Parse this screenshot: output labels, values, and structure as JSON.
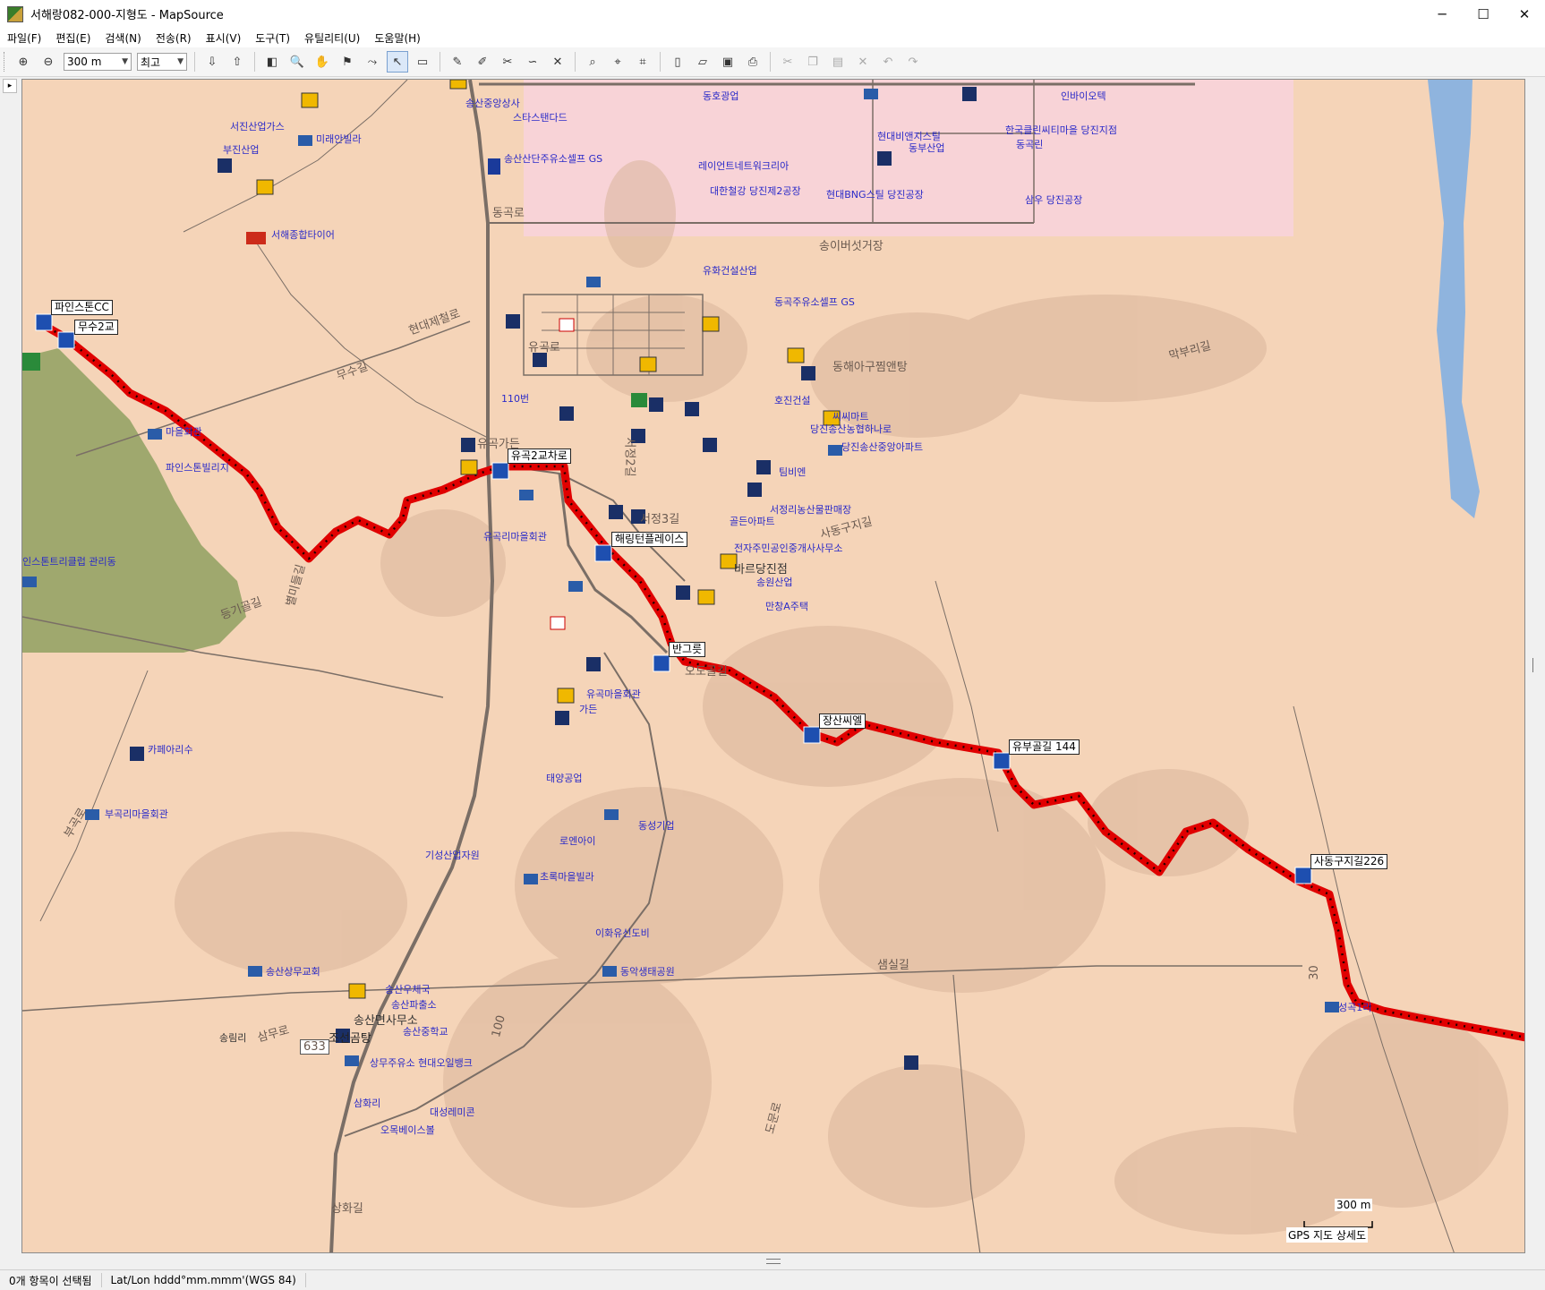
{
  "window": {
    "title": "서해랑082-000-지형도 - MapSource",
    "controls": {
      "minimize": "─",
      "maximize": "☐",
      "close": "✕"
    }
  },
  "menu": [
    "파일(F)",
    "편집(E)",
    "검색(N)",
    "전송(R)",
    "표시(V)",
    "도구(T)",
    "유틸리티(U)",
    "도움말(H)"
  ],
  "toolbar": {
    "zoom_value": "300 m",
    "detail_value": "최고"
  },
  "map": {
    "colors": {
      "land": "#f5d4b8",
      "urban": "#f8d3d7",
      "water": "#8fb4de",
      "golf": "#9fa86e",
      "route": "#e00000",
      "road": "#7a6e66"
    },
    "road_labels": [
      {
        "text": "동곡로"
      },
      {
        "text": "현대제철로"
      },
      {
        "text": "무수길"
      },
      {
        "text": "유곡로"
      },
      {
        "text": "서정2길"
      },
      {
        "text": "서정3길"
      },
      {
        "text": "등기골길"
      },
      {
        "text": "별미들길"
      },
      {
        "text": "사동구지길"
      },
      {
        "text": "오도골길"
      },
      {
        "text": "샘실길"
      },
      {
        "text": "삼무로"
      },
      {
        "text": "도문로"
      },
      {
        "text": "상화길"
      },
      {
        "text": "유곡가든"
      },
      {
        "text": "막부리길"
      },
      {
        "text": "송이버섯거장"
      },
      {
        "text": "동해아구찜앤탕"
      },
      {
        "text": "부곡로"
      },
      {
        "text": "633"
      },
      {
        "text": "100"
      },
      {
        "text": "30"
      }
    ],
    "poi_labels": [
      {
        "text": "송산중앙상사"
      },
      {
        "text": "스타스탠다드"
      },
      {
        "text": "서진산업가스"
      },
      {
        "text": "부진산업"
      },
      {
        "text": "미래안빌라"
      },
      {
        "text": "송산산단주유소셀프 GS"
      },
      {
        "text": "서해종합타이어"
      },
      {
        "text": "동호광업"
      },
      {
        "text": "레이언트네트워크리아"
      },
      {
        "text": "대한철강 당진제2공장"
      },
      {
        "text": "현대BNG스틸 당진공장"
      },
      {
        "text": "현대비앤지스틸"
      },
      {
        "text": "동부산업"
      },
      {
        "text": "한국클린씨티마을 당진지점"
      },
      {
        "text": "동곡린"
      },
      {
        "text": "삼우 당진공장"
      },
      {
        "text": "인바이오텍"
      },
      {
        "text": "유화건설산업"
      },
      {
        "text": "동곡주유소셀프 GS"
      },
      {
        "text": "마을회관"
      },
      {
        "text": "110번"
      },
      {
        "text": "호진건설"
      },
      {
        "text": "씨씨마트"
      },
      {
        "text": "당진송산농협하나로"
      },
      {
        "text": "당진송산중앙아파트"
      },
      {
        "text": "팀비엔"
      },
      {
        "text": "서정리농산물판매장"
      },
      {
        "text": "유곡리마을회관"
      },
      {
        "text": "전자주민공인중개사사무소"
      },
      {
        "text": "바르당진점"
      },
      {
        "text": "골든아파트"
      },
      {
        "text": "송원산업"
      },
      {
        "text": "만창A주택"
      },
      {
        "text": "유곡마을회관"
      },
      {
        "text": "가든"
      },
      {
        "text": "카페아리수"
      },
      {
        "text": "부곡리마을회관"
      },
      {
        "text": "태양공업"
      },
      {
        "text": "동성기업"
      },
      {
        "text": "로엔아이"
      },
      {
        "text": "기성산업자원"
      },
      {
        "text": "초록마을빌라"
      },
      {
        "text": "이화유신도비"
      },
      {
        "text": "송산상무교회"
      },
      {
        "text": "동악생태공원"
      },
      {
        "text": "상무주유소 현대오일뱅크"
      },
      {
        "text": "대성레미콘"
      },
      {
        "text": "삼화리"
      },
      {
        "text": "오목베이스볼"
      },
      {
        "text": "송림리"
      },
      {
        "text": "인스톤트리클럽 관리동"
      },
      {
        "text": "파인스톤빌리지"
      },
      {
        "text": "송산면사무소"
      },
      {
        "text": "송산파출소"
      },
      {
        "text": "송산우체국"
      },
      {
        "text": "송산중학교"
      },
      {
        "text": "조선곰탕"
      },
      {
        "text": "성곡1리"
      }
    ],
    "waypoints": [
      "파인스톤CC",
      "무수2교",
      "유곡2교차로",
      "해링턴플레이스",
      "반그릇",
      "장산씨엘",
      "유부골길 144",
      "사동구지길226"
    ],
    "scale_label": "300 m",
    "map_name": "GPS 지도 상세도"
  },
  "status": {
    "selection": "0개 항목이 선택됨",
    "coord_format": "Lat/Lon hddd°mm.mmm'(WGS 84)"
  }
}
